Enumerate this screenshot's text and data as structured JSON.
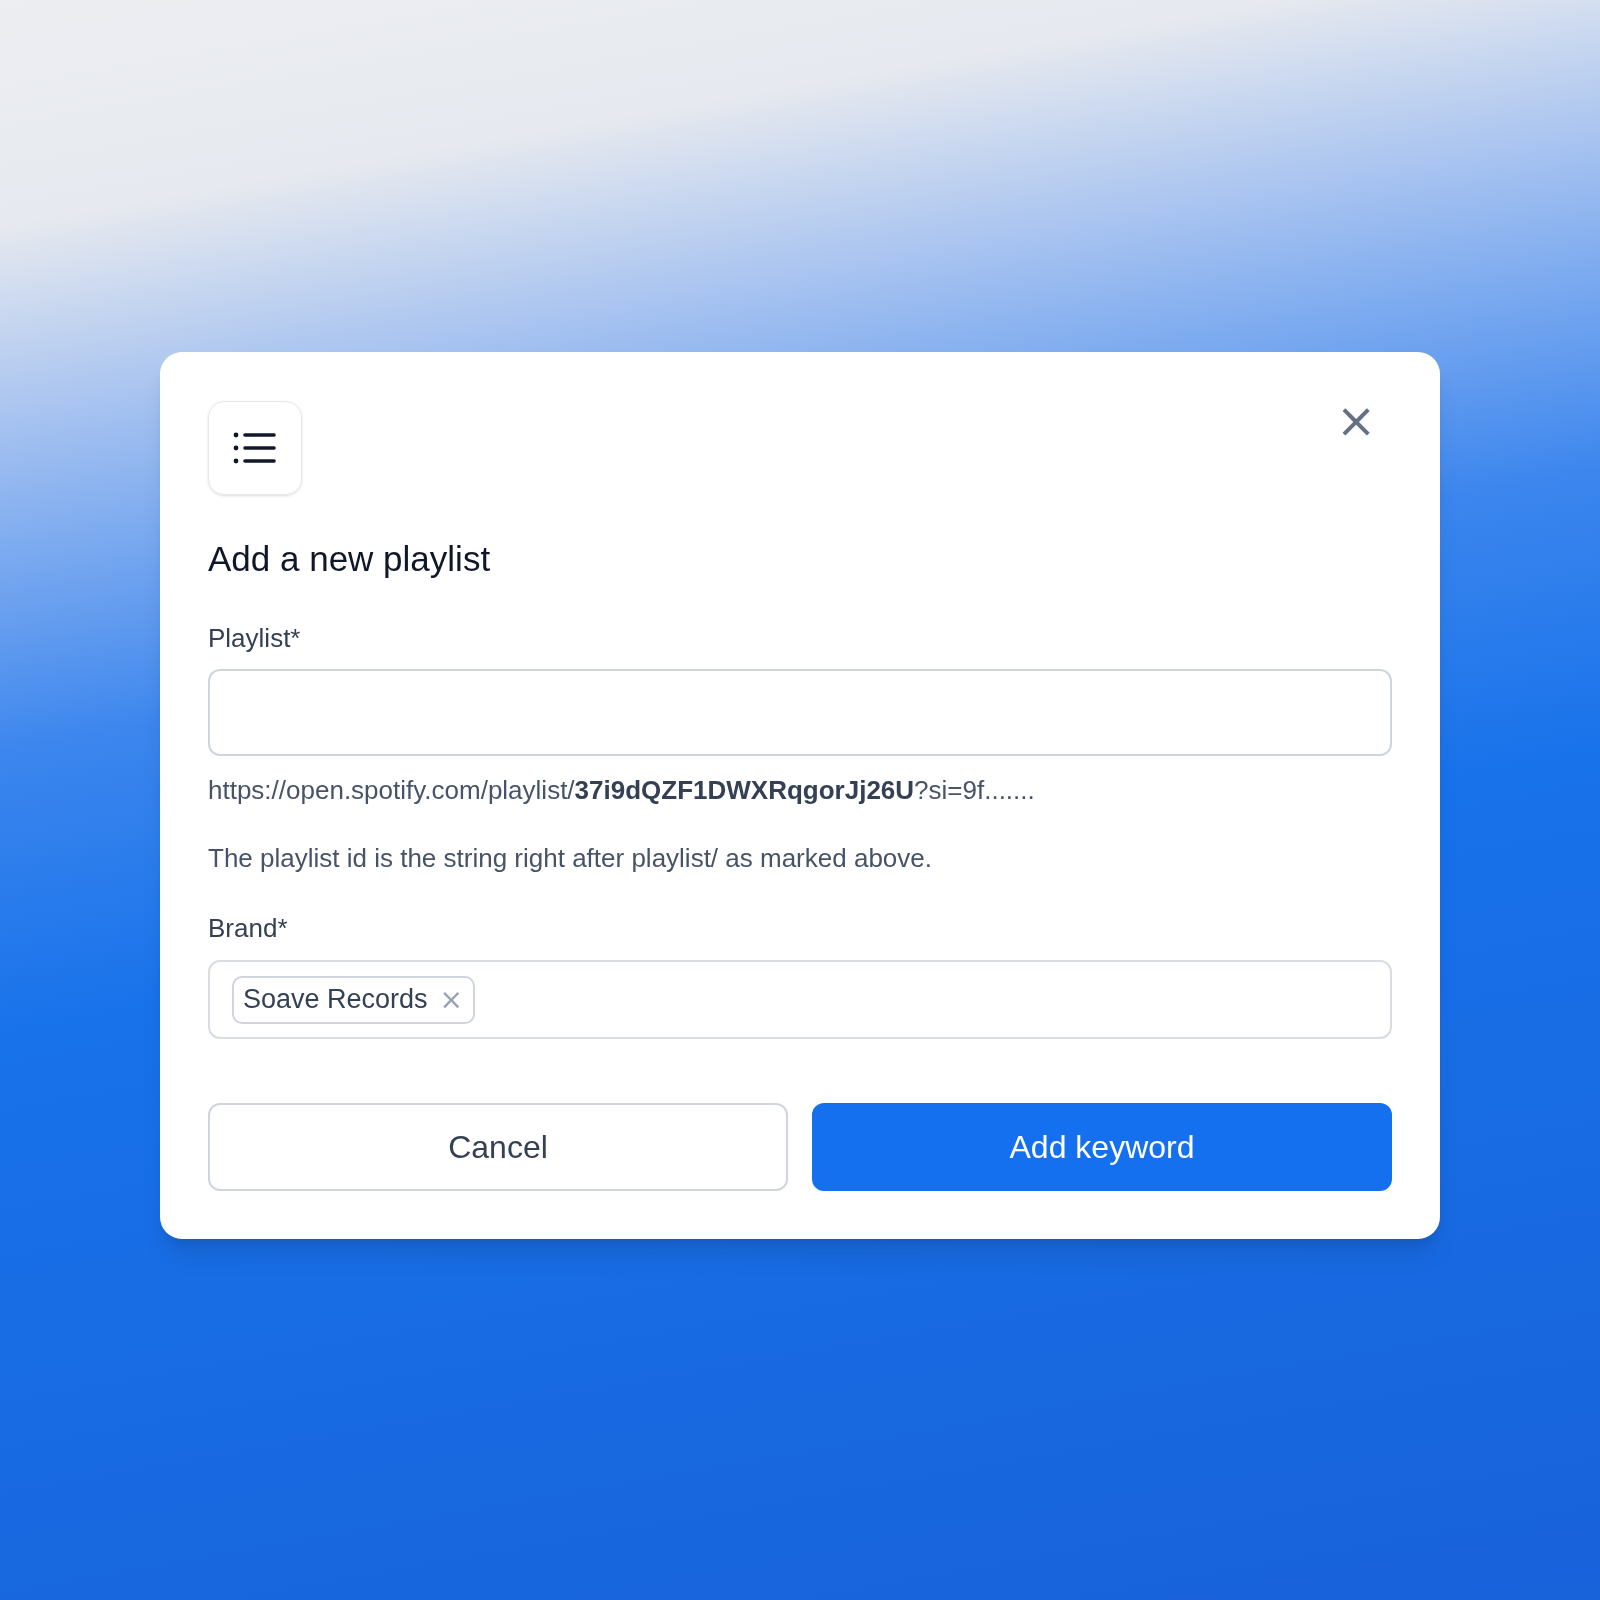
{
  "dialog": {
    "title": "Add a new playlist",
    "close_icon": "×",
    "playlist_field": {
      "label": "Playlist*"
    },
    "example_url": "https://open.spotify.com/playlist/**37i9dQZF1DWXRqgorJj26U**?si=9f.......",
    "help_text": "The playlist id is the string right after playlist/ as marked above.",
    "brand_field": {
      "label": "Brand*",
      "tags": [
        {
          "label": "Soave Records",
          "remove": "×"
        }
      ]
    },
    "buttons": [
      {
        "label": "Cancel",
        "kind": "secondary"
      },
      {
        "label": "Add keyword",
        "kind": "primary"
      }
    ]
  }
}
